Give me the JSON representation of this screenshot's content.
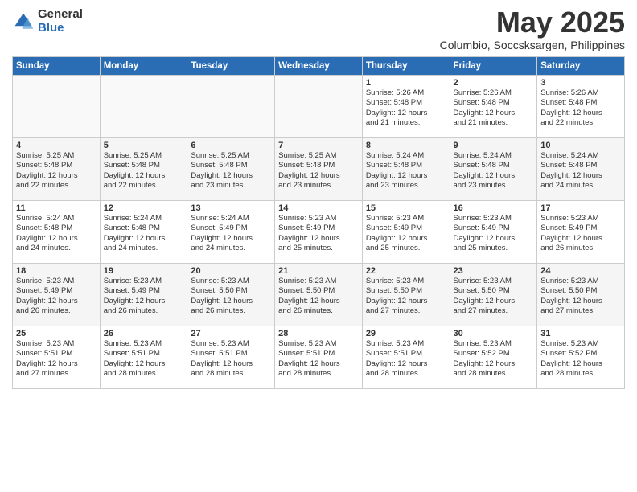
{
  "logo": {
    "general": "General",
    "blue": "Blue"
  },
  "title": "May 2025",
  "subtitle": "Columbio, Soccsksargen, Philippines",
  "days": [
    "Sunday",
    "Monday",
    "Tuesday",
    "Wednesday",
    "Thursday",
    "Friday",
    "Saturday"
  ],
  "rows": [
    [
      {
        "day": "",
        "content": ""
      },
      {
        "day": "",
        "content": ""
      },
      {
        "day": "",
        "content": ""
      },
      {
        "day": "",
        "content": ""
      },
      {
        "day": "1",
        "content": "Sunrise: 5:26 AM\nSunset: 5:48 PM\nDaylight: 12 hours\nand 21 minutes."
      },
      {
        "day": "2",
        "content": "Sunrise: 5:26 AM\nSunset: 5:48 PM\nDaylight: 12 hours\nand 21 minutes."
      },
      {
        "day": "3",
        "content": "Sunrise: 5:26 AM\nSunset: 5:48 PM\nDaylight: 12 hours\nand 22 minutes."
      }
    ],
    [
      {
        "day": "4",
        "content": "Sunrise: 5:25 AM\nSunset: 5:48 PM\nDaylight: 12 hours\nand 22 minutes."
      },
      {
        "day": "5",
        "content": "Sunrise: 5:25 AM\nSunset: 5:48 PM\nDaylight: 12 hours\nand 22 minutes."
      },
      {
        "day": "6",
        "content": "Sunrise: 5:25 AM\nSunset: 5:48 PM\nDaylight: 12 hours\nand 23 minutes."
      },
      {
        "day": "7",
        "content": "Sunrise: 5:25 AM\nSunset: 5:48 PM\nDaylight: 12 hours\nand 23 minutes."
      },
      {
        "day": "8",
        "content": "Sunrise: 5:24 AM\nSunset: 5:48 PM\nDaylight: 12 hours\nand 23 minutes."
      },
      {
        "day": "9",
        "content": "Sunrise: 5:24 AM\nSunset: 5:48 PM\nDaylight: 12 hours\nand 23 minutes."
      },
      {
        "day": "10",
        "content": "Sunrise: 5:24 AM\nSunset: 5:48 PM\nDaylight: 12 hours\nand 24 minutes."
      }
    ],
    [
      {
        "day": "11",
        "content": "Sunrise: 5:24 AM\nSunset: 5:48 PM\nDaylight: 12 hours\nand 24 minutes."
      },
      {
        "day": "12",
        "content": "Sunrise: 5:24 AM\nSunset: 5:48 PM\nDaylight: 12 hours\nand 24 minutes."
      },
      {
        "day": "13",
        "content": "Sunrise: 5:24 AM\nSunset: 5:49 PM\nDaylight: 12 hours\nand 24 minutes."
      },
      {
        "day": "14",
        "content": "Sunrise: 5:23 AM\nSunset: 5:49 PM\nDaylight: 12 hours\nand 25 minutes."
      },
      {
        "day": "15",
        "content": "Sunrise: 5:23 AM\nSunset: 5:49 PM\nDaylight: 12 hours\nand 25 minutes."
      },
      {
        "day": "16",
        "content": "Sunrise: 5:23 AM\nSunset: 5:49 PM\nDaylight: 12 hours\nand 25 minutes."
      },
      {
        "day": "17",
        "content": "Sunrise: 5:23 AM\nSunset: 5:49 PM\nDaylight: 12 hours\nand 26 minutes."
      }
    ],
    [
      {
        "day": "18",
        "content": "Sunrise: 5:23 AM\nSunset: 5:49 PM\nDaylight: 12 hours\nand 26 minutes."
      },
      {
        "day": "19",
        "content": "Sunrise: 5:23 AM\nSunset: 5:49 PM\nDaylight: 12 hours\nand 26 minutes."
      },
      {
        "day": "20",
        "content": "Sunrise: 5:23 AM\nSunset: 5:50 PM\nDaylight: 12 hours\nand 26 minutes."
      },
      {
        "day": "21",
        "content": "Sunrise: 5:23 AM\nSunset: 5:50 PM\nDaylight: 12 hours\nand 26 minutes."
      },
      {
        "day": "22",
        "content": "Sunrise: 5:23 AM\nSunset: 5:50 PM\nDaylight: 12 hours\nand 27 minutes."
      },
      {
        "day": "23",
        "content": "Sunrise: 5:23 AM\nSunset: 5:50 PM\nDaylight: 12 hours\nand 27 minutes."
      },
      {
        "day": "24",
        "content": "Sunrise: 5:23 AM\nSunset: 5:50 PM\nDaylight: 12 hours\nand 27 minutes."
      }
    ],
    [
      {
        "day": "25",
        "content": "Sunrise: 5:23 AM\nSunset: 5:51 PM\nDaylight: 12 hours\nand 27 minutes."
      },
      {
        "day": "26",
        "content": "Sunrise: 5:23 AM\nSunset: 5:51 PM\nDaylight: 12 hours\nand 28 minutes."
      },
      {
        "day": "27",
        "content": "Sunrise: 5:23 AM\nSunset: 5:51 PM\nDaylight: 12 hours\nand 28 minutes."
      },
      {
        "day": "28",
        "content": "Sunrise: 5:23 AM\nSunset: 5:51 PM\nDaylight: 12 hours\nand 28 minutes."
      },
      {
        "day": "29",
        "content": "Sunrise: 5:23 AM\nSunset: 5:51 PM\nDaylight: 12 hours\nand 28 minutes."
      },
      {
        "day": "30",
        "content": "Sunrise: 5:23 AM\nSunset: 5:52 PM\nDaylight: 12 hours\nand 28 minutes."
      },
      {
        "day": "31",
        "content": "Sunrise: 5:23 AM\nSunset: 5:52 PM\nDaylight: 12 hours\nand 28 minutes."
      }
    ]
  ]
}
